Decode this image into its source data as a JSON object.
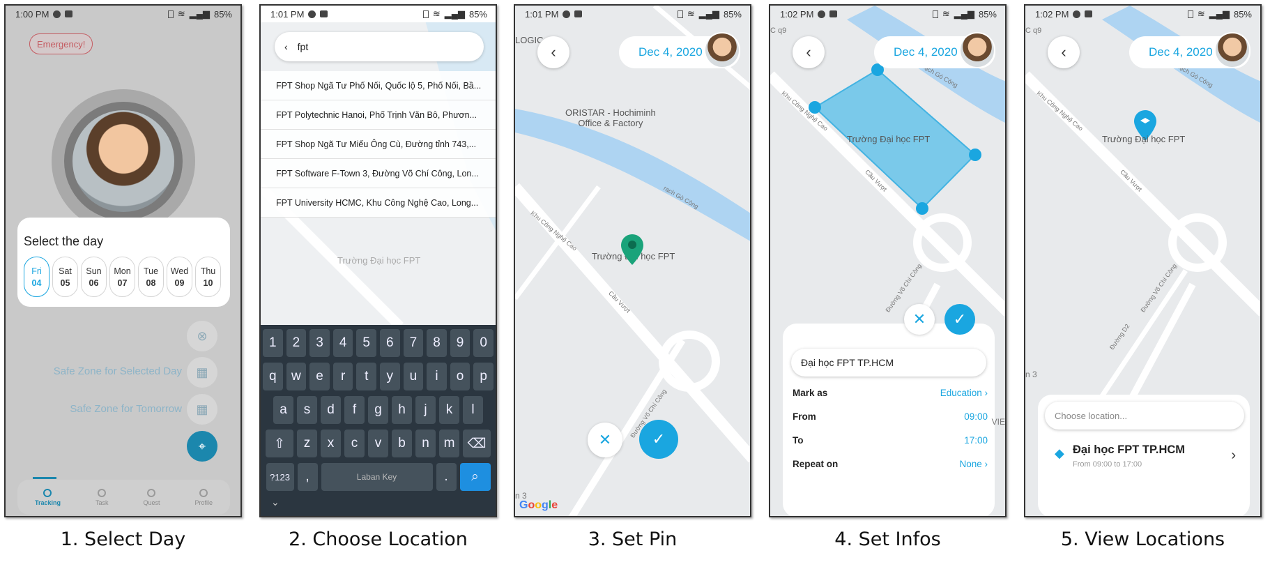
{
  "captions": [
    "1. Select Day",
    "2. Choose Location",
    "3. Set Pin",
    "4. Set Infos",
    "5. View Locations"
  ],
  "status": {
    "p1": {
      "time": "1:00 PM",
      "battery": "85%"
    },
    "p2": {
      "time": "1:01 PM",
      "battery": "85%"
    },
    "p3": {
      "time": "1:01 PM",
      "battery": "85%"
    },
    "p4": {
      "time": "1:02 PM",
      "battery": "85%"
    },
    "p5": {
      "time": "1:02 PM",
      "battery": "85%"
    }
  },
  "panel1": {
    "emergency_label": "Emergency!",
    "select_title": "Select the day",
    "days": [
      {
        "name": "Fri",
        "num": "04",
        "active": true
      },
      {
        "name": "Sat",
        "num": "05"
      },
      {
        "name": "Sun",
        "num": "06"
      },
      {
        "name": "Mon",
        "num": "07"
      },
      {
        "name": "Tue",
        "num": "08"
      },
      {
        "name": "Wed",
        "num": "09"
      },
      {
        "name": "Thu",
        "num": "10"
      }
    ],
    "safe_zone_selected": "Safe Zone for Selected Day",
    "safe_zone_tomorrow": "Safe Zone for Tomorrow",
    "nav": [
      "Tracking",
      "Task",
      "Quest",
      "Profile"
    ],
    "nav_active": "Tracking"
  },
  "panel2": {
    "search_value": "fpt",
    "results": [
      "FPT Shop Ngã Tư Phố Nối, Quốc lộ 5, Phố Nối, Bầ...",
      "FPT Polytechnic Hanoi, Phố Trịnh Văn Bô, Phươn...",
      "FPT Shop Ngã Tư Miếu Ông Cù, Đường tỉnh 743,...",
      "FPT Software F-Town 3, Đường Võ Chí Công, Lon...",
      "FPT University HCMC, Khu Công Nghệ Cao, Long..."
    ],
    "keyboard": {
      "row_numbers": [
        "1",
        "2",
        "3",
        "4",
        "5",
        "6",
        "7",
        "8",
        "9",
        "0"
      ],
      "row1": [
        "q",
        "w",
        "e",
        "r",
        "t",
        "y",
        "u",
        "i",
        "o",
        "p"
      ],
      "row2": [
        "a",
        "s",
        "d",
        "f",
        "g",
        "h",
        "j",
        "k",
        "l"
      ],
      "row3": [
        "z",
        "x",
        "c",
        "v",
        "b",
        "n",
        "m"
      ],
      "symbols_label": "?123",
      "comma": ",",
      "space_label": "Laban Key",
      "period": "."
    },
    "map_labels": {
      "truong": "Trường Đại học FPT",
      "oristar": "Office & Factory"
    }
  },
  "map": {
    "date": "Dec 4, 2020",
    "oristar": "ORISTAR - Hochiminh",
    "oristar2": "Office & Factory",
    "logic": "LOGIC",
    "truong": "Trường Đại học FPT",
    "khu_cong_nghe": "Khu Công Nghệ Cao",
    "cau_vuot": "Cầu Vượt",
    "vo_chi_cong": "Đường Võ Chí Công",
    "duong": "Đường",
    "duong_d2": "Đường D2",
    "rach_go_cong": "rạch Gò Công",
    "q9": "C q9",
    "n3": "n 3",
    "vie": "VIE",
    "google": [
      "G",
      "o",
      "o",
      "g",
      "l",
      "e"
    ]
  },
  "panel4": {
    "name_value": "Đại học FPT TP.HCM",
    "mark_label": "Mark as",
    "mark_value": "Education",
    "from_label": "From",
    "from_value": "09:00",
    "to_label": "To",
    "to_value": "17:00",
    "repeat_label": "Repeat on",
    "repeat_value": "None"
  },
  "panel5": {
    "choose_placeholder": "Choose location...",
    "loc_title": "Đại học FPT TP.HCM",
    "loc_sub": "From 09:00 to 17:00"
  },
  "colors": {
    "accent": "#1aa6e0",
    "pin_green": "#1aa37a",
    "dark_teal": "#1b87ad",
    "emergency": "#c45b61"
  }
}
